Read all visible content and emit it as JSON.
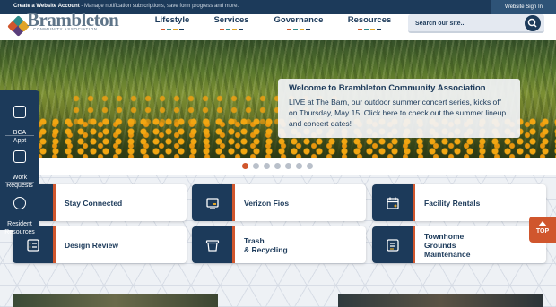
{
  "topbar": {
    "create_label": "Create a Website Account",
    "create_desc": " - Manage notification subscriptions, save form progress and more.",
    "signin_label": "Website Sign In"
  },
  "logo": {
    "name": "Brambleton",
    "tagline": "COMMUNITY ASSOCIATION",
    "colors": [
      "#d0562d",
      "#2e8b8a",
      "#e0a425",
      "#5a3e7a"
    ]
  },
  "nav": {
    "items": [
      {
        "label": "Lifestyle",
        "colors": [
          "#d0562d",
          "#2e8b8a",
          "#e0a425",
          "#1c3a5a"
        ]
      },
      {
        "label": "Services",
        "colors": [
          "#d0562d",
          "#2e8b8a",
          "#e0a425",
          "#1c3a5a"
        ]
      },
      {
        "label": "Governance",
        "colors": [
          "#d0562d",
          "#2e8b8a",
          "#e0a425",
          "#1c3a5a"
        ]
      },
      {
        "label": "Resources",
        "colors": [
          "#d0562d",
          "#2e8b8a",
          "#e0a425",
          "#1c3a5a"
        ]
      }
    ]
  },
  "search": {
    "placeholder": "Search our site...",
    "icon": "search-icon"
  },
  "hero": {
    "title": "Welcome to Brambleton Community Association",
    "body": "LIVE at The Barn, our outdoor summer concert series, kicks off on Thursday, May 15. Click here to check out the summer lineup and concert dates!",
    "slide_count": 7,
    "active_slide": 1
  },
  "quick_links": [
    {
      "label": "BCA\nAppt",
      "icon": "calendar-icon"
    },
    {
      "label": "Work\nRequests",
      "icon": "clipboard-icon"
    },
    {
      "label": "Resident\nResources",
      "icon": "person-icon"
    }
  ],
  "cards": [
    {
      "label": "Stay Connected",
      "icon": "envelope-icon"
    },
    {
      "label": "Verizon Fios",
      "icon": "tv-icon"
    },
    {
      "label": "Facility Rentals",
      "icon": "calendar-icon"
    },
    {
      "label": "Design Review",
      "icon": "checklist-icon"
    },
    {
      "label": "Trash\n& Recycling",
      "icon": "trash-bin-icon"
    },
    {
      "label": "Townhome\nGrounds\nMaintenance",
      "icon": "list-icon"
    }
  ],
  "top_button": {
    "label": "TOP",
    "icon": "arrow-up-icon"
  },
  "colors": {
    "navy": "#1c3a5a",
    "accent": "#d0562d"
  }
}
